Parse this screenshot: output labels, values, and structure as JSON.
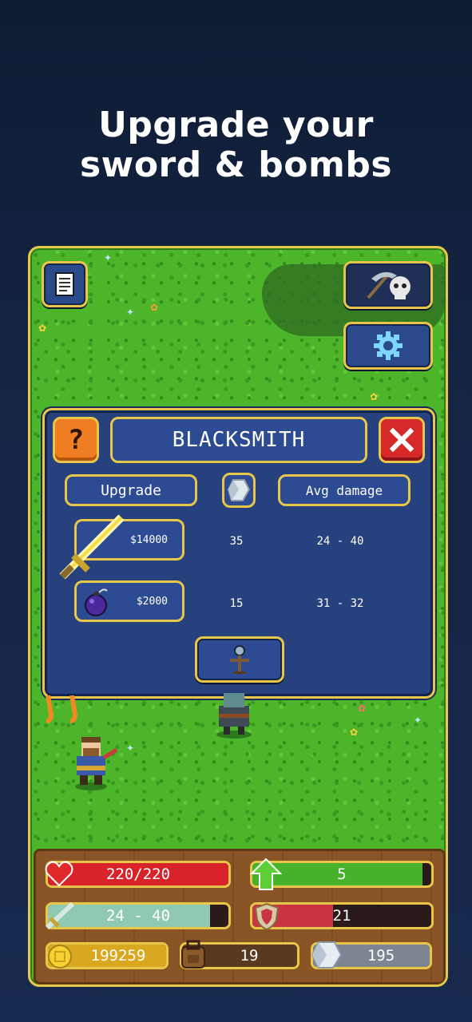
{
  "headline": {
    "line1": "Upgrade your",
    "line2": "sword & bombs"
  },
  "top_buttons": {
    "log_icon": "document-icon",
    "skull_icon": "skull-scythe-icon",
    "settings_icon": "gear-icon"
  },
  "blacksmith": {
    "title": "BLACKSMITH",
    "help_label": "?",
    "columns": {
      "upgrade": "Upgrade",
      "avg_damage": "Avg damage",
      "crystal_icon": "crystal-icon"
    },
    "rows": [
      {
        "item": "sword",
        "icon": "sword-icon",
        "cost": "$14000",
        "crystals": "35",
        "damage": "24 - 40"
      },
      {
        "item": "bomb",
        "icon": "bomb-icon",
        "cost": "$2000",
        "crystals": "15",
        "damage": "31 - 32"
      }
    ],
    "extra_button_icon": "training-dummy-icon"
  },
  "hud": {
    "health": {
      "value": "220/220",
      "fill_fraction": 1.0,
      "color": "#d8232a"
    },
    "level": {
      "value": "5",
      "fill_fraction": 0.95,
      "color": "#47b32c"
    },
    "damage": {
      "value": "24 - 40",
      "fill_fraction": 0.9,
      "color": "#8fc9b0"
    },
    "armor": {
      "value": "21",
      "fill_fraction": 0.45,
      "color": "#c93444"
    },
    "gold": {
      "value": "199259",
      "color": "#d9a820"
    },
    "bag": {
      "value": "19",
      "color": "#5a3a1e"
    },
    "crystals": {
      "value": "195",
      "color": "#7d8590"
    }
  },
  "colors": {
    "accent_gold": "#e7c64a",
    "panel_blue": "#27417e",
    "grass": "#4cb52a"
  }
}
